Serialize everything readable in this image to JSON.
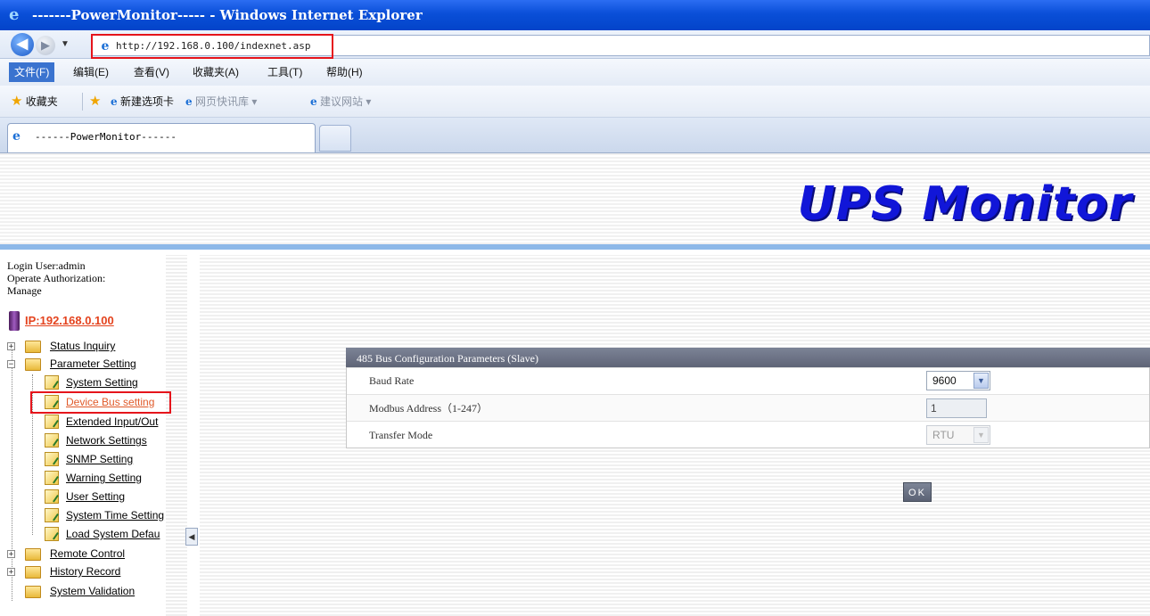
{
  "window": {
    "title": "-------PowerMonitor----- - Windows Internet Explorer"
  },
  "addressbar": {
    "url": "http://192.168.0.100/indexnet.asp"
  },
  "menu": [
    "文件(F)",
    "编辑(E)",
    "查看(V)",
    "收藏夹(A)",
    "工具(T)",
    "帮助(H)"
  ],
  "favorites": {
    "favorites_label": "收藏夹",
    "items": [
      "新建选项卡",
      "网页快讯库 ▾",
      "建议网站 ▾"
    ]
  },
  "tab": {
    "title": "------PowerMonitor------"
  },
  "header": {
    "title": "UPS Monitor"
  },
  "login": {
    "user_line": "Login User:admin",
    "auth_line": "Operate Authorization:",
    "auth_value": "Manage",
    "ip": "IP:192.168.0.100"
  },
  "tree": [
    {
      "label": "Status Inquiry"
    },
    {
      "label": "Parameter Setting"
    },
    {
      "label": "System Setting"
    },
    {
      "label": "Device Bus setting"
    },
    {
      "label": "Extended Input/Out"
    },
    {
      "label": "Network Settings"
    },
    {
      "label": "SNMP Setting"
    },
    {
      "label": "Warning Setting"
    },
    {
      "label": "User Setting"
    },
    {
      "label": "System Time Setting"
    },
    {
      "label": "Load System Defau"
    },
    {
      "label": "Remote Control"
    },
    {
      "label": "History Record"
    },
    {
      "label": "System Validation"
    }
  ],
  "panel": {
    "title": "485 Bus Configuration Parameters (Slave)",
    "baud_label": "Baud Rate",
    "baud_value": "9600",
    "modbus_label": "Modbus Address（1-247）",
    "modbus_value": "1",
    "transfer_label": "Transfer Mode",
    "transfer_value": "RTU"
  },
  "ok_button": "OK"
}
